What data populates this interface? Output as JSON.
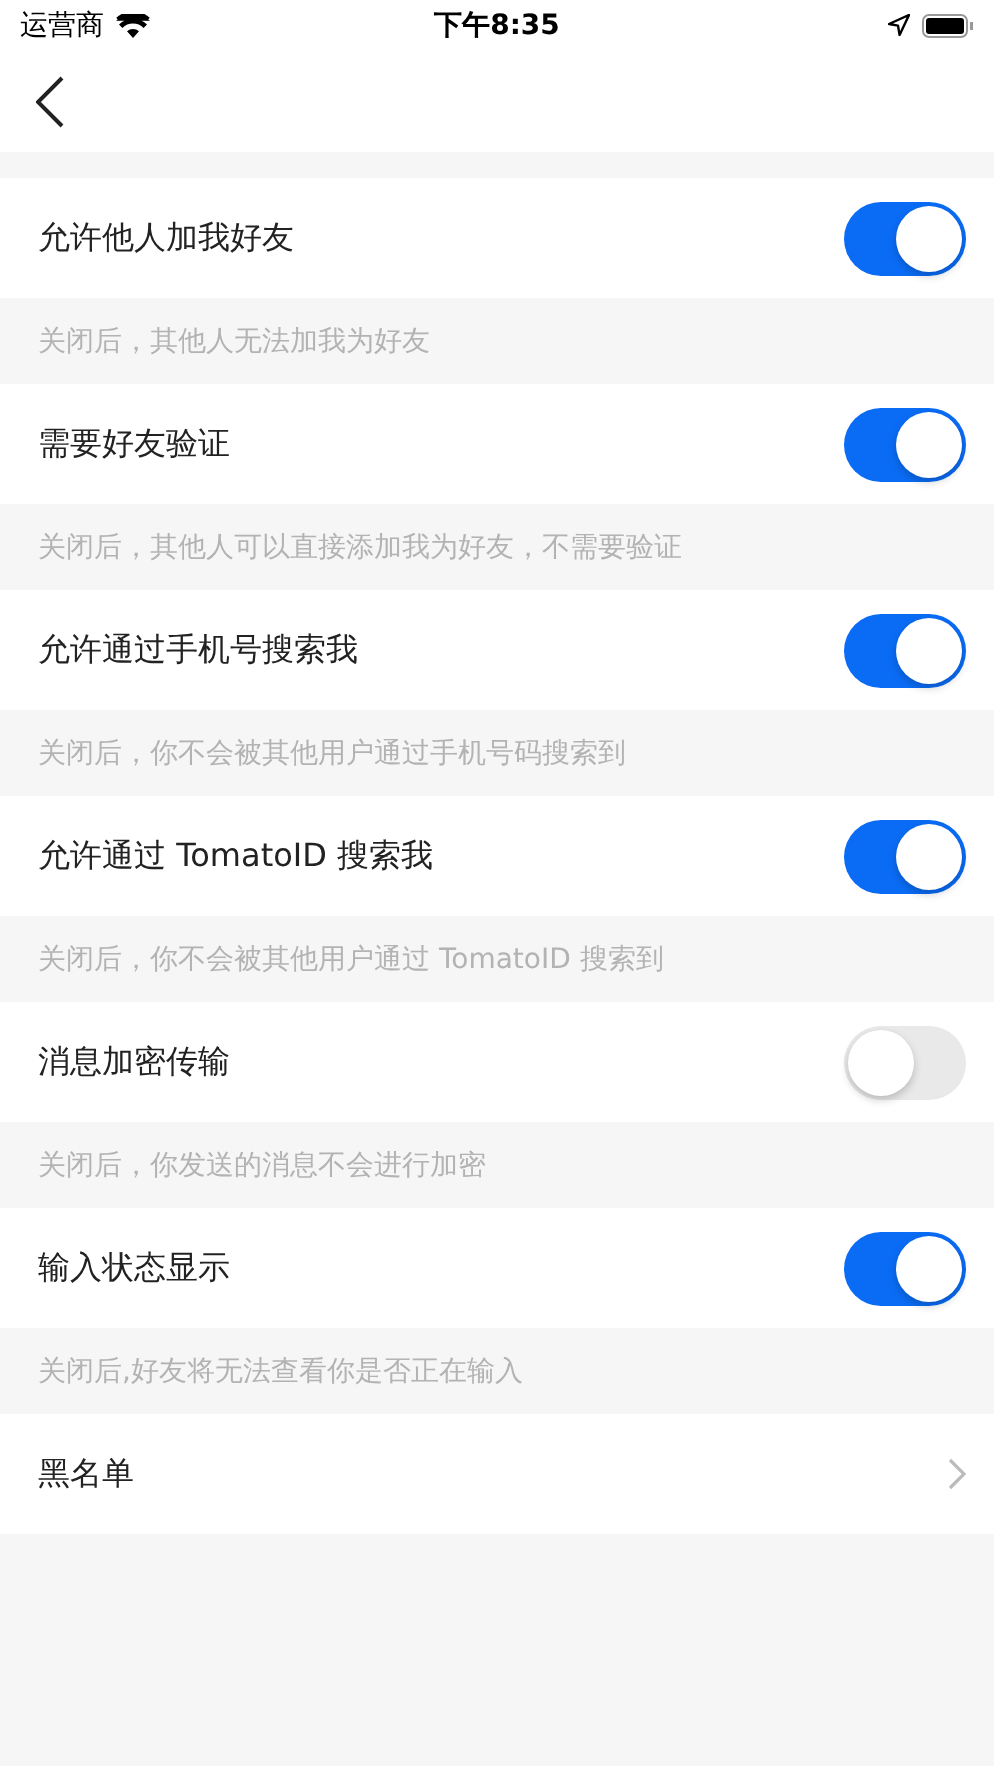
{
  "status_bar": {
    "carrier": "运营商",
    "time": "下午8:35"
  },
  "settings": [
    {
      "kind": "toggle",
      "label": "允许他人加我好友",
      "on": true,
      "hint": "关闭后，其他人无法加我为好友"
    },
    {
      "kind": "toggle",
      "label": "需要好友验证",
      "on": true,
      "hint": "关闭后，其他人可以直接添加我为好友，不需要验证"
    },
    {
      "kind": "toggle",
      "label": "允许通过手机号搜索我",
      "on": true,
      "hint": "关闭后，你不会被其他用户通过手机号码搜索到"
    },
    {
      "kind": "toggle",
      "label": "允许通过 TomatoID 搜索我",
      "on": true,
      "hint": "关闭后，你不会被其他用户通过 TomatoID 搜索到"
    },
    {
      "kind": "toggle",
      "label": "消息加密传输",
      "on": false,
      "hint": "关闭后，你发送的消息不会进行加密"
    },
    {
      "kind": "toggle",
      "label": "输入状态显示",
      "on": true,
      "hint": "关闭后,好友将无法查看你是否正在输入"
    },
    {
      "kind": "link",
      "label": "黑名单"
    }
  ]
}
